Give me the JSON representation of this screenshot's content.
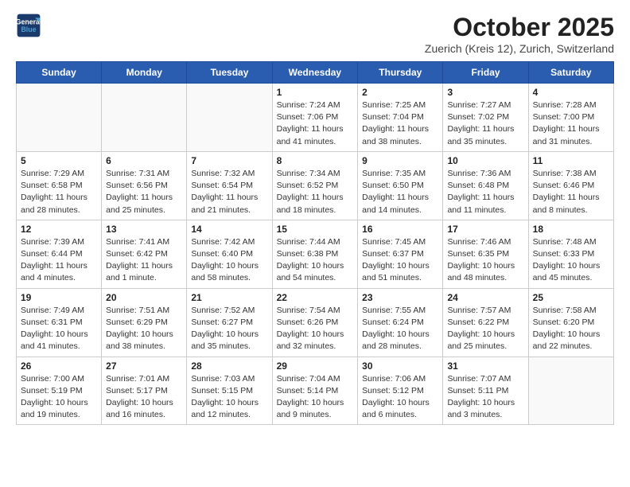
{
  "header": {
    "logo_line1": "General",
    "logo_line2": "Blue",
    "month": "October 2025",
    "location": "Zuerich (Kreis 12), Zurich, Switzerland"
  },
  "days_of_week": [
    "Sunday",
    "Monday",
    "Tuesday",
    "Wednesday",
    "Thursday",
    "Friday",
    "Saturday"
  ],
  "weeks": [
    [
      {
        "day": "",
        "info": ""
      },
      {
        "day": "",
        "info": ""
      },
      {
        "day": "",
        "info": ""
      },
      {
        "day": "1",
        "info": "Sunrise: 7:24 AM\nSunset: 7:06 PM\nDaylight: 11 hours\nand 41 minutes."
      },
      {
        "day": "2",
        "info": "Sunrise: 7:25 AM\nSunset: 7:04 PM\nDaylight: 11 hours\nand 38 minutes."
      },
      {
        "day": "3",
        "info": "Sunrise: 7:27 AM\nSunset: 7:02 PM\nDaylight: 11 hours\nand 35 minutes."
      },
      {
        "day": "4",
        "info": "Sunrise: 7:28 AM\nSunset: 7:00 PM\nDaylight: 11 hours\nand 31 minutes."
      }
    ],
    [
      {
        "day": "5",
        "info": "Sunrise: 7:29 AM\nSunset: 6:58 PM\nDaylight: 11 hours\nand 28 minutes."
      },
      {
        "day": "6",
        "info": "Sunrise: 7:31 AM\nSunset: 6:56 PM\nDaylight: 11 hours\nand 25 minutes."
      },
      {
        "day": "7",
        "info": "Sunrise: 7:32 AM\nSunset: 6:54 PM\nDaylight: 11 hours\nand 21 minutes."
      },
      {
        "day": "8",
        "info": "Sunrise: 7:34 AM\nSunset: 6:52 PM\nDaylight: 11 hours\nand 18 minutes."
      },
      {
        "day": "9",
        "info": "Sunrise: 7:35 AM\nSunset: 6:50 PM\nDaylight: 11 hours\nand 14 minutes."
      },
      {
        "day": "10",
        "info": "Sunrise: 7:36 AM\nSunset: 6:48 PM\nDaylight: 11 hours\nand 11 minutes."
      },
      {
        "day": "11",
        "info": "Sunrise: 7:38 AM\nSunset: 6:46 PM\nDaylight: 11 hours\nand 8 minutes."
      }
    ],
    [
      {
        "day": "12",
        "info": "Sunrise: 7:39 AM\nSunset: 6:44 PM\nDaylight: 11 hours\nand 4 minutes."
      },
      {
        "day": "13",
        "info": "Sunrise: 7:41 AM\nSunset: 6:42 PM\nDaylight: 11 hours\nand 1 minute."
      },
      {
        "day": "14",
        "info": "Sunrise: 7:42 AM\nSunset: 6:40 PM\nDaylight: 10 hours\nand 58 minutes."
      },
      {
        "day": "15",
        "info": "Sunrise: 7:44 AM\nSunset: 6:38 PM\nDaylight: 10 hours\nand 54 minutes."
      },
      {
        "day": "16",
        "info": "Sunrise: 7:45 AM\nSunset: 6:37 PM\nDaylight: 10 hours\nand 51 minutes."
      },
      {
        "day": "17",
        "info": "Sunrise: 7:46 AM\nSunset: 6:35 PM\nDaylight: 10 hours\nand 48 minutes."
      },
      {
        "day": "18",
        "info": "Sunrise: 7:48 AM\nSunset: 6:33 PM\nDaylight: 10 hours\nand 45 minutes."
      }
    ],
    [
      {
        "day": "19",
        "info": "Sunrise: 7:49 AM\nSunset: 6:31 PM\nDaylight: 10 hours\nand 41 minutes."
      },
      {
        "day": "20",
        "info": "Sunrise: 7:51 AM\nSunset: 6:29 PM\nDaylight: 10 hours\nand 38 minutes."
      },
      {
        "day": "21",
        "info": "Sunrise: 7:52 AM\nSunset: 6:27 PM\nDaylight: 10 hours\nand 35 minutes."
      },
      {
        "day": "22",
        "info": "Sunrise: 7:54 AM\nSunset: 6:26 PM\nDaylight: 10 hours\nand 32 minutes."
      },
      {
        "day": "23",
        "info": "Sunrise: 7:55 AM\nSunset: 6:24 PM\nDaylight: 10 hours\nand 28 minutes."
      },
      {
        "day": "24",
        "info": "Sunrise: 7:57 AM\nSunset: 6:22 PM\nDaylight: 10 hours\nand 25 minutes."
      },
      {
        "day": "25",
        "info": "Sunrise: 7:58 AM\nSunset: 6:20 PM\nDaylight: 10 hours\nand 22 minutes."
      }
    ],
    [
      {
        "day": "26",
        "info": "Sunrise: 7:00 AM\nSunset: 5:19 PM\nDaylight: 10 hours\nand 19 minutes."
      },
      {
        "day": "27",
        "info": "Sunrise: 7:01 AM\nSunset: 5:17 PM\nDaylight: 10 hours\nand 16 minutes."
      },
      {
        "day": "28",
        "info": "Sunrise: 7:03 AM\nSunset: 5:15 PM\nDaylight: 10 hours\nand 12 minutes."
      },
      {
        "day": "29",
        "info": "Sunrise: 7:04 AM\nSunset: 5:14 PM\nDaylight: 10 hours\nand 9 minutes."
      },
      {
        "day": "30",
        "info": "Sunrise: 7:06 AM\nSunset: 5:12 PM\nDaylight: 10 hours\nand 6 minutes."
      },
      {
        "day": "31",
        "info": "Sunrise: 7:07 AM\nSunset: 5:11 PM\nDaylight: 10 hours\nand 3 minutes."
      },
      {
        "day": "",
        "info": ""
      }
    ]
  ]
}
